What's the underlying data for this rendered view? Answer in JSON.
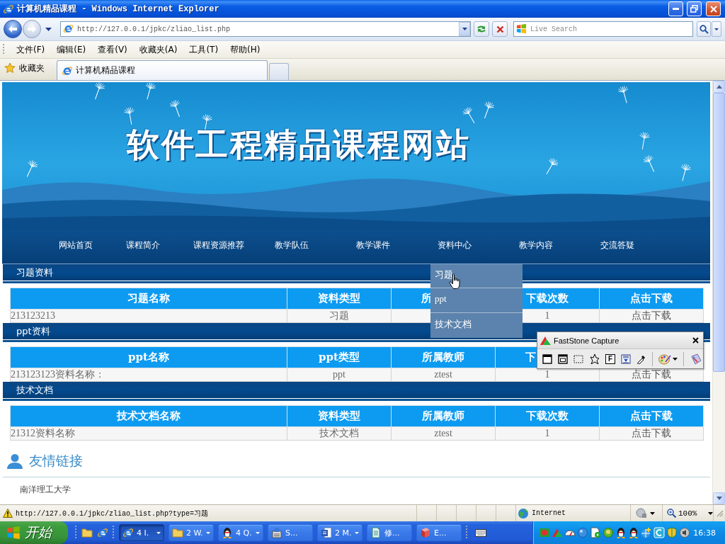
{
  "window": {
    "title": "计算机精品课程 - Windows Internet Explorer"
  },
  "address_bar": {
    "url": "http://127.0.0.1/jpkc/zliao_list.php"
  },
  "search": {
    "placeholder": "Live Search"
  },
  "menu": [
    "文件(F)",
    "编辑(E)",
    "查看(V)",
    "收藏夹(A)",
    "工具(T)",
    "帮助(H)"
  ],
  "favorites": {
    "label": "收藏夹"
  },
  "tabs": [
    {
      "label": "计算机精品课程",
      "selected": true
    }
  ],
  "page": {
    "banner_title": "软件工程精品课程网站",
    "nav": [
      {
        "label": "网站首页"
      },
      {
        "label": "课程简介"
      },
      {
        "label": "课程资源推荐"
      },
      {
        "label": "教学队伍"
      },
      {
        "label": "教学课件"
      },
      {
        "label": "资料中心",
        "items": [
          "习题",
          "ppt",
          "技术文档"
        ]
      },
      {
        "label": "教学内容"
      },
      {
        "label": "交流答疑"
      }
    ],
    "sections": [
      {
        "title": "习题资料",
        "columns": [
          {
            "label": "习题名称",
            "clipped": false
          },
          {
            "label": "资料类型",
            "clipped": false
          },
          {
            "label": "所",
            "clipped": true
          },
          {
            "label": "下载次数",
            "clipped": false
          },
          {
            "label": "点击下载",
            "clipped": false
          }
        ],
        "rows": [
          {
            "name": "213123213",
            "type": "习题",
            "downloads": "1",
            "link": "点击下载"
          }
        ]
      },
      {
        "title": "ppt资料",
        "columns": [
          {
            "label": "ppt名称",
            "clipped": false
          },
          {
            "label": "ppt类型",
            "clipped": false
          },
          {
            "label": "所属教师",
            "clipped": false
          },
          {
            "label": "下",
            "clipped": true
          }
        ],
        "rows": [
          {
            "name": "213123123资料名称：",
            "type": "ppt",
            "teacher": "ztest",
            "downloads": "1",
            "link": "点击下载"
          }
        ]
      },
      {
        "title": "技术文档",
        "columns": [
          {
            "label": "技术文档名称",
            "clipped": false
          },
          {
            "label": "资料类型",
            "clipped": false
          },
          {
            "label": "所属教师",
            "clipped": false
          },
          {
            "label": "下载次数",
            "clipped": false
          },
          {
            "label": "点击下载",
            "clipped": false
          }
        ],
        "rows": [
          {
            "name": "21312资料名称",
            "type": "技术文档",
            "teacher": "ztest",
            "downloads": "1",
            "link": "点击下载"
          }
        ]
      }
    ],
    "links": {
      "title": "友情链接",
      "items": [
        "南洋理工大学"
      ]
    }
  },
  "status_bar": {
    "url": "http://127.0.0.1/jpkc/zliao_list.php?type=习题",
    "zone": "Internet",
    "zoom": "100%"
  },
  "capture_toolbar": {
    "title": "FastStone Capture",
    "tools": [
      {
        "kind": "window"
      },
      {
        "kind": "object"
      },
      {
        "kind": "rectangle"
      },
      {
        "kind": "freehand"
      },
      {
        "kind": "fixed",
        "label": "F"
      },
      {
        "kind": "scrolling"
      },
      {
        "kind": "picker"
      },
      {
        "kind": "separator"
      },
      {
        "kind": "palette"
      },
      {
        "kind": "separator"
      },
      {
        "kind": "editor"
      }
    ]
  },
  "taskbar": {
    "start": "开始",
    "tasks": [
      {
        "label": "4 I.",
        "kind": "browser",
        "grouped": true,
        "selected": true
      },
      {
        "label": "2 W.",
        "kind": "folder",
        "grouped": true,
        "selected": false
      },
      {
        "label": "4 Q.",
        "kind": "chat",
        "grouped": true,
        "selected": false
      },
      {
        "label": "S...",
        "kind": "setup",
        "grouped": false,
        "selected": false
      },
      {
        "label": "2 M.",
        "kind": "word",
        "grouped": true,
        "selected": false
      },
      {
        "label": "修...",
        "kind": "document",
        "grouped": false,
        "selected": false
      },
      {
        "label": "E...",
        "kind": "book",
        "grouped": false,
        "selected": false
      }
    ],
    "clock": "16:38"
  }
}
